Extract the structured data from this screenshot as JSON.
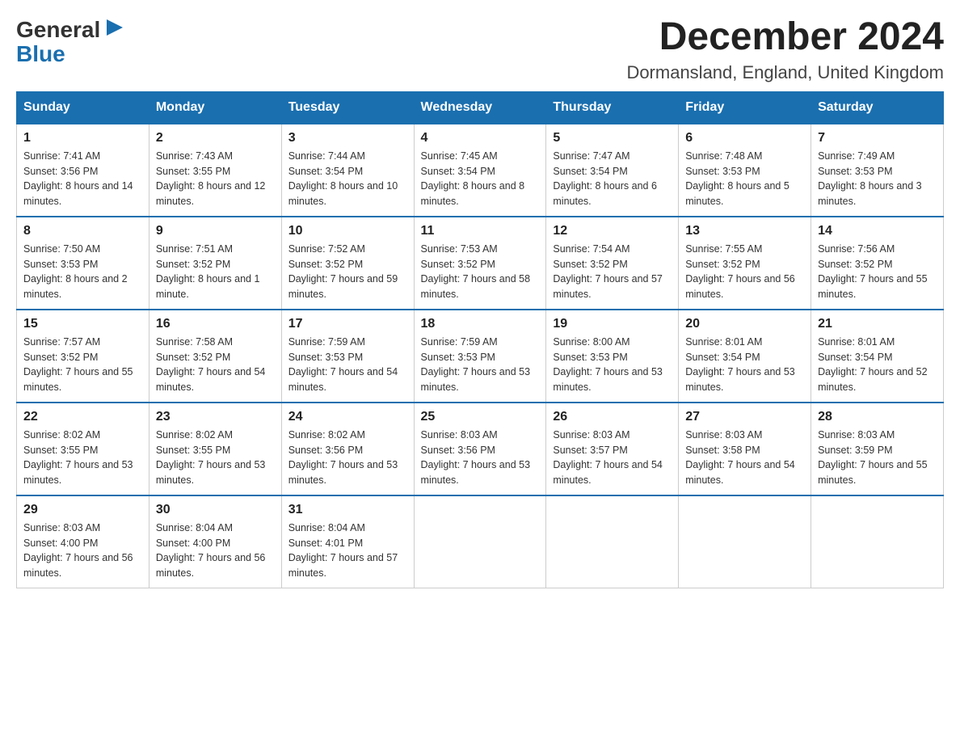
{
  "logo": {
    "general": "General",
    "blue": "Blue"
  },
  "title": {
    "month_year": "December 2024",
    "location": "Dormansland, England, United Kingdom"
  },
  "weekdays": [
    "Sunday",
    "Monday",
    "Tuesday",
    "Wednesday",
    "Thursday",
    "Friday",
    "Saturday"
  ],
  "weeks": [
    [
      {
        "day": 1,
        "sunrise": "7:41 AM",
        "sunset": "3:56 PM",
        "daylight": "8 hours and 14 minutes."
      },
      {
        "day": 2,
        "sunrise": "7:43 AM",
        "sunset": "3:55 PM",
        "daylight": "8 hours and 12 minutes."
      },
      {
        "day": 3,
        "sunrise": "7:44 AM",
        "sunset": "3:54 PM",
        "daylight": "8 hours and 10 minutes."
      },
      {
        "day": 4,
        "sunrise": "7:45 AM",
        "sunset": "3:54 PM",
        "daylight": "8 hours and 8 minutes."
      },
      {
        "day": 5,
        "sunrise": "7:47 AM",
        "sunset": "3:54 PM",
        "daylight": "8 hours and 6 minutes."
      },
      {
        "day": 6,
        "sunrise": "7:48 AM",
        "sunset": "3:53 PM",
        "daylight": "8 hours and 5 minutes."
      },
      {
        "day": 7,
        "sunrise": "7:49 AM",
        "sunset": "3:53 PM",
        "daylight": "8 hours and 3 minutes."
      }
    ],
    [
      {
        "day": 8,
        "sunrise": "7:50 AM",
        "sunset": "3:53 PM",
        "daylight": "8 hours and 2 minutes."
      },
      {
        "day": 9,
        "sunrise": "7:51 AM",
        "sunset": "3:52 PM",
        "daylight": "8 hours and 1 minute."
      },
      {
        "day": 10,
        "sunrise": "7:52 AM",
        "sunset": "3:52 PM",
        "daylight": "7 hours and 59 minutes."
      },
      {
        "day": 11,
        "sunrise": "7:53 AM",
        "sunset": "3:52 PM",
        "daylight": "7 hours and 58 minutes."
      },
      {
        "day": 12,
        "sunrise": "7:54 AM",
        "sunset": "3:52 PM",
        "daylight": "7 hours and 57 minutes."
      },
      {
        "day": 13,
        "sunrise": "7:55 AM",
        "sunset": "3:52 PM",
        "daylight": "7 hours and 56 minutes."
      },
      {
        "day": 14,
        "sunrise": "7:56 AM",
        "sunset": "3:52 PM",
        "daylight": "7 hours and 55 minutes."
      }
    ],
    [
      {
        "day": 15,
        "sunrise": "7:57 AM",
        "sunset": "3:52 PM",
        "daylight": "7 hours and 55 minutes."
      },
      {
        "day": 16,
        "sunrise": "7:58 AM",
        "sunset": "3:52 PM",
        "daylight": "7 hours and 54 minutes."
      },
      {
        "day": 17,
        "sunrise": "7:59 AM",
        "sunset": "3:53 PM",
        "daylight": "7 hours and 54 minutes."
      },
      {
        "day": 18,
        "sunrise": "7:59 AM",
        "sunset": "3:53 PM",
        "daylight": "7 hours and 53 minutes."
      },
      {
        "day": 19,
        "sunrise": "8:00 AM",
        "sunset": "3:53 PM",
        "daylight": "7 hours and 53 minutes."
      },
      {
        "day": 20,
        "sunrise": "8:01 AM",
        "sunset": "3:54 PM",
        "daylight": "7 hours and 53 minutes."
      },
      {
        "day": 21,
        "sunrise": "8:01 AM",
        "sunset": "3:54 PM",
        "daylight": "7 hours and 52 minutes."
      }
    ],
    [
      {
        "day": 22,
        "sunrise": "8:02 AM",
        "sunset": "3:55 PM",
        "daylight": "7 hours and 53 minutes."
      },
      {
        "day": 23,
        "sunrise": "8:02 AM",
        "sunset": "3:55 PM",
        "daylight": "7 hours and 53 minutes."
      },
      {
        "day": 24,
        "sunrise": "8:02 AM",
        "sunset": "3:56 PM",
        "daylight": "7 hours and 53 minutes."
      },
      {
        "day": 25,
        "sunrise": "8:03 AM",
        "sunset": "3:56 PM",
        "daylight": "7 hours and 53 minutes."
      },
      {
        "day": 26,
        "sunrise": "8:03 AM",
        "sunset": "3:57 PM",
        "daylight": "7 hours and 54 minutes."
      },
      {
        "day": 27,
        "sunrise": "8:03 AM",
        "sunset": "3:58 PM",
        "daylight": "7 hours and 54 minutes."
      },
      {
        "day": 28,
        "sunrise": "8:03 AM",
        "sunset": "3:59 PM",
        "daylight": "7 hours and 55 minutes."
      }
    ],
    [
      {
        "day": 29,
        "sunrise": "8:03 AM",
        "sunset": "4:00 PM",
        "daylight": "7 hours and 56 minutes."
      },
      {
        "day": 30,
        "sunrise": "8:04 AM",
        "sunset": "4:00 PM",
        "daylight": "7 hours and 56 minutes."
      },
      {
        "day": 31,
        "sunrise": "8:04 AM",
        "sunset": "4:01 PM",
        "daylight": "7 hours and 57 minutes."
      },
      null,
      null,
      null,
      null
    ]
  ]
}
